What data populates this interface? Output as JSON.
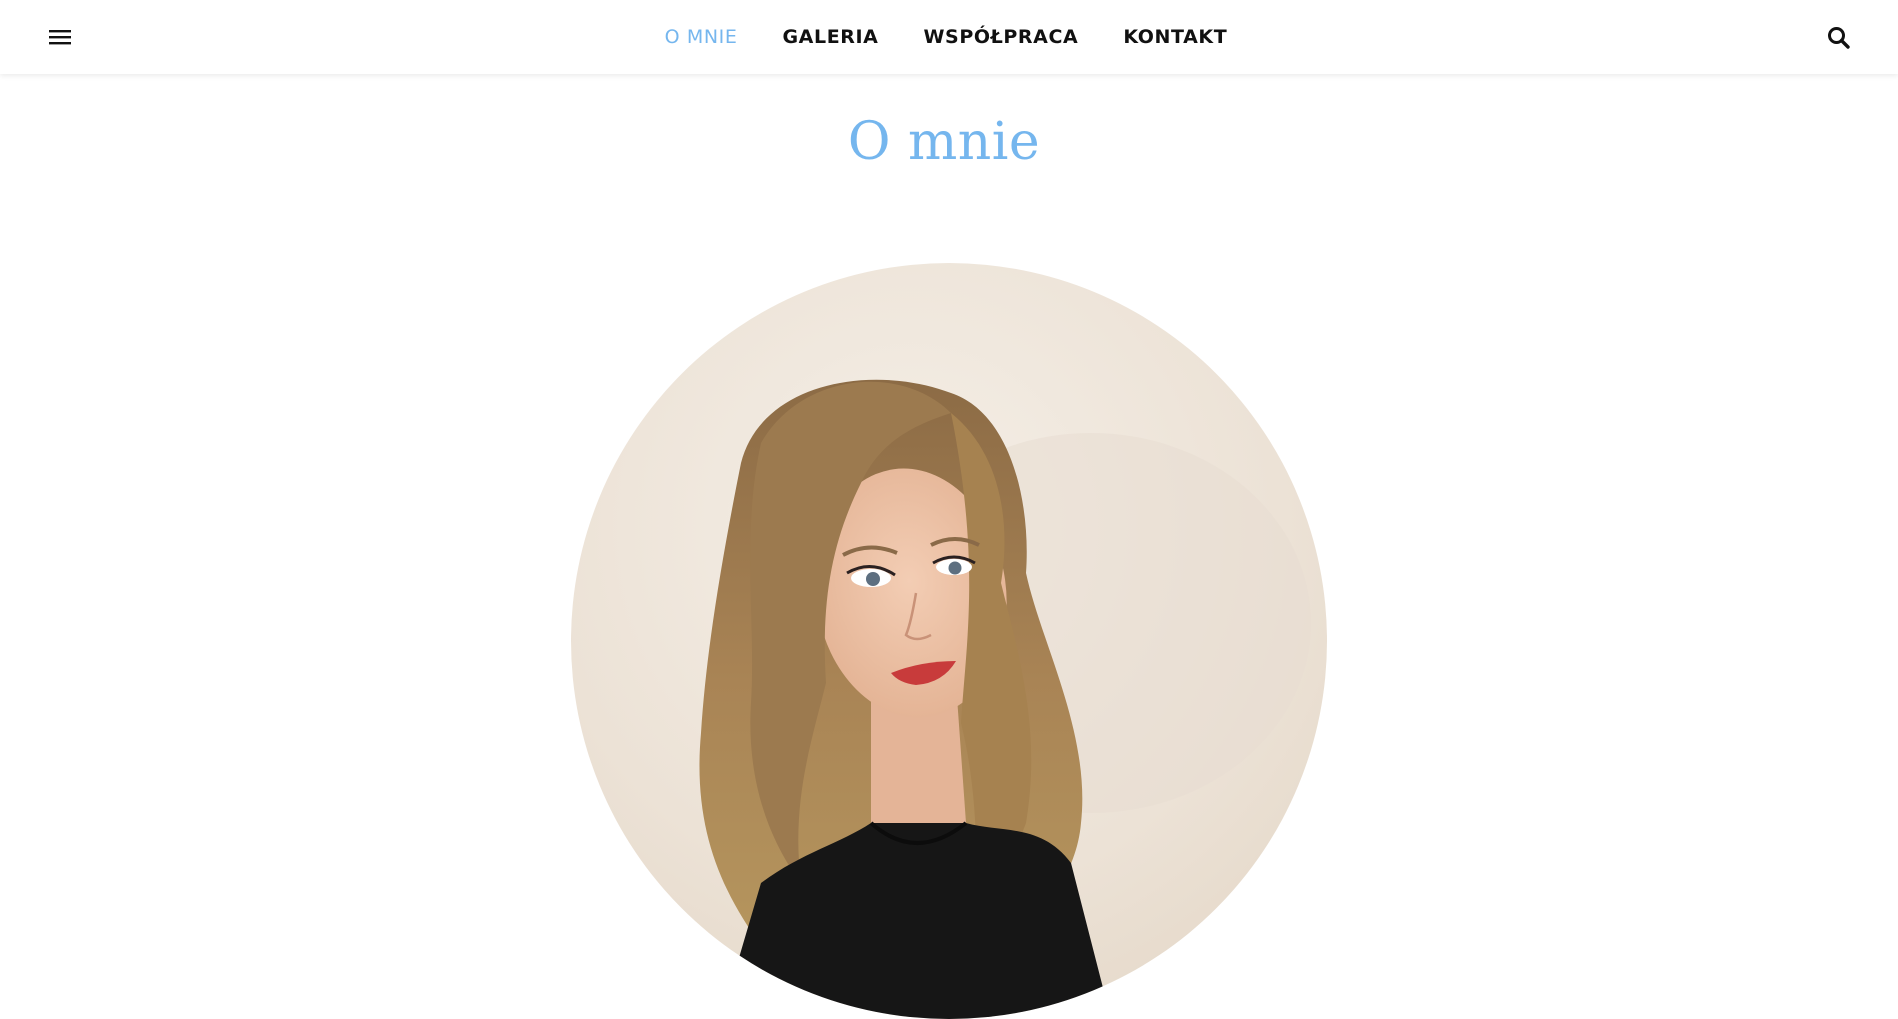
{
  "header": {
    "menu_icon": "hamburger-icon",
    "search_icon": "search-icon",
    "nav": [
      {
        "label": "O MNIE",
        "active": true
      },
      {
        "label": "GALERIA",
        "active": false
      },
      {
        "label": "WSPÓŁPRACA",
        "active": false
      },
      {
        "label": "KONTAKT",
        "active": false
      }
    ]
  },
  "main": {
    "title": "O mnie"
  },
  "colors": {
    "accent": "#75b6ee",
    "text": "#111111",
    "background": "#ffffff",
    "portrait_background": "#efe6dc"
  }
}
